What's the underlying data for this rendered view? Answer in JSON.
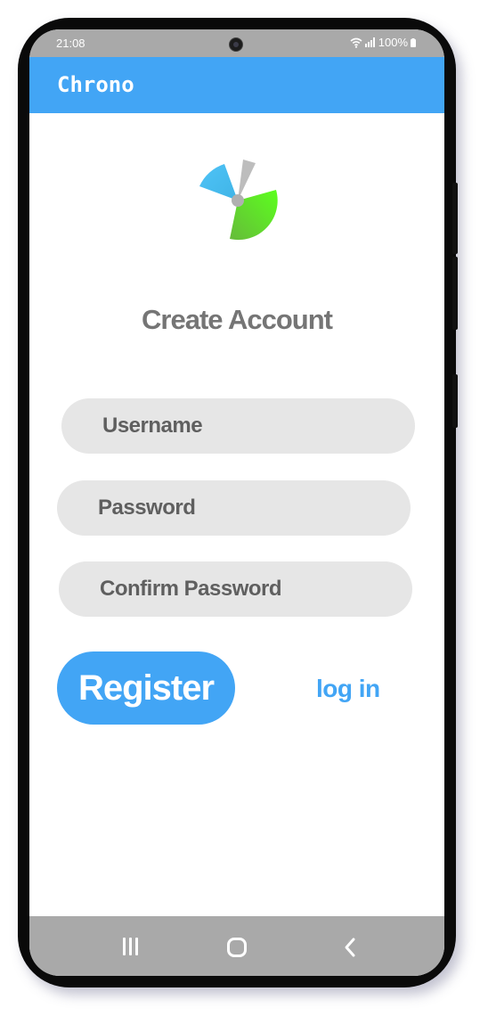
{
  "status_bar": {
    "time": "21:08",
    "battery": "100%"
  },
  "app_bar": {
    "title": "Chrono",
    "color": "#42a5f5"
  },
  "logo": {
    "name": "chrono-logo-icon",
    "colors": [
      "#4fc3f7",
      "#bdbdbd",
      "#4caf50",
      "#76ff03"
    ]
  },
  "form": {
    "heading": "Create Account",
    "username_placeholder": "Username",
    "password_placeholder": "Password",
    "confirm_password_placeholder": "Confirm Password",
    "register_label": "Register",
    "login_label": "log in"
  },
  "nav_bar": {
    "items": [
      "recent-apps-icon",
      "home-icon",
      "back-icon"
    ]
  }
}
